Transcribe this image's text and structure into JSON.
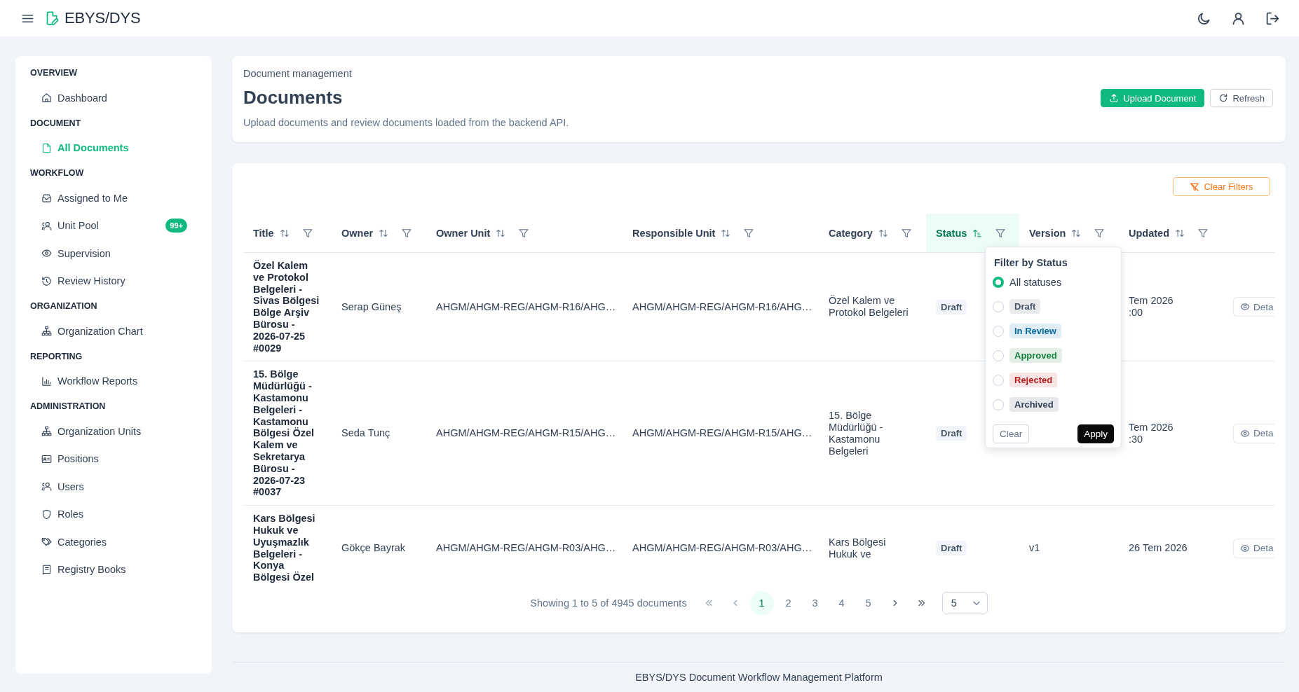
{
  "topbar": {
    "brand": "EBYS/DYS"
  },
  "sidebar": {
    "sections": [
      {
        "heading": "OVERVIEW",
        "items": [
          {
            "label": "Dashboard",
            "selected": false
          }
        ]
      },
      {
        "heading": "DOCUMENT",
        "items": [
          {
            "label": "All Documents",
            "selected": true
          }
        ]
      },
      {
        "heading": "WORKFLOW",
        "items": [
          {
            "label": "Assigned to Me",
            "selected": false
          },
          {
            "label": "Unit Pool",
            "selected": false,
            "badge": "99+"
          },
          {
            "label": "Supervision",
            "selected": false
          },
          {
            "label": "Review History",
            "selected": false
          }
        ]
      },
      {
        "heading": "ORGANIZATION",
        "items": [
          {
            "label": "Organization Chart",
            "selected": false
          }
        ]
      },
      {
        "heading": "REPORTING",
        "items": [
          {
            "label": "Workflow Reports",
            "selected": false
          }
        ]
      },
      {
        "heading": "ADMINISTRATION",
        "items": [
          {
            "label": "Organization Units",
            "selected": false
          },
          {
            "label": "Positions",
            "selected": false
          },
          {
            "label": "Users",
            "selected": false
          },
          {
            "label": "Roles",
            "selected": false
          },
          {
            "label": "Categories",
            "selected": false
          },
          {
            "label": "Registry Books",
            "selected": false
          }
        ]
      }
    ]
  },
  "page_header": {
    "breadcrumb": "Document management",
    "title": "Documents",
    "description": "Upload documents and review documents loaded from the backend API.",
    "buttons": [
      {
        "label": "Upload Document",
        "kind": "primary"
      },
      {
        "label": "Refresh",
        "kind": "secondary"
      }
    ]
  },
  "documents_table": {
    "clear_filters": "Clear Filters",
    "columns": [
      {
        "label": "Title",
        "sorted": false
      },
      {
        "label": "Owner",
        "sorted": false
      },
      {
        "label": "Owner Unit",
        "sorted": false
      },
      {
        "label": "Responsible Unit",
        "sorted": false
      },
      {
        "label": "Category",
        "sorted": false
      },
      {
        "label": "Status",
        "sorted": true
      },
      {
        "label": "Version",
        "sorted": false
      },
      {
        "label": "Updated",
        "sorted": false
      }
    ],
    "rows": [
      {
        "title": "Özel Kalem ve Protokol Belgeleri - Sivas Bölgesi Bölge Arşiv Bürosu - 2026-07-25 #0029",
        "owner": "Serap Güneş",
        "owner_unit": "AHGM/AHGM-REG/AHGM-R16/AHG…",
        "responsible_unit": "AHGM/AHGM-REG/AHGM-R16/AHG…",
        "category": "Özel Kalem ve Protokol Belgeleri",
        "status": "Draft",
        "updated": "Tem 2026\n:00",
        "action": "Deta"
      },
      {
        "title": "15. Bölge Müdürlüğü - Kastamonu Belgeleri - Kastamonu Bölgesi Özel Kalem ve Sekretarya Bürosu - 2026-07-23 #0037",
        "owner": "Seda Tunç",
        "owner_unit": "AHGM/AHGM-REG/AHGM-R15/AHG…",
        "responsible_unit": "AHGM/AHGM-REG/AHGM-R15/AHG…",
        "category": "15. Bölge Müdürlüğü - Kastamonu Belgeleri",
        "status": "Draft",
        "updated": "Tem 2026\n:30",
        "action": "Deta"
      },
      {
        "title": "Kars Bölgesi Hukuk ve Uyuşmazlık Belgeleri - Konya Bölgesi Özel",
        "owner": "Gökçe Bayrak",
        "owner_unit": "AHGM/AHGM-REG/AHGM-R03/AHG…",
        "responsible_unit": "AHGM/AHGM-REG/AHGM-R03/AHG…",
        "category": "Kars Bölgesi Hukuk ve",
        "status": "Draft",
        "version": "v1",
        "updated": "26 Tem 2026",
        "action": "Deta"
      }
    ],
    "status_filter": {
      "title": "Filter by Status",
      "options": [
        {
          "label": "All statuses",
          "kind": "plain",
          "selected": true
        },
        {
          "label": "Draft",
          "kind": "badge",
          "color": "#475569",
          "selected": false
        },
        {
          "label": "In Review",
          "kind": "badge",
          "color": "#0369a1",
          "selected": false
        },
        {
          "label": "Approved",
          "kind": "badge",
          "color": "#15803d",
          "selected": false
        },
        {
          "label": "Rejected",
          "kind": "badge",
          "color": "#b91c1c",
          "selected": false
        },
        {
          "label": "Archived",
          "kind": "badge",
          "color": "#334155",
          "selected": false
        }
      ],
      "clear": "Clear",
      "apply": "Apply"
    },
    "pagination": {
      "summary": "Showing 1 to 5 of 4945 documents",
      "nav_before": [
        {
          "kind": "first",
          "disabled": true
        },
        {
          "kind": "previous",
          "disabled": true
        }
      ],
      "pages": [
        {
          "label": "1",
          "selected": true
        },
        {
          "label": "2",
          "selected": false
        },
        {
          "label": "3",
          "selected": false
        },
        {
          "label": "4",
          "selected": false
        },
        {
          "label": "5",
          "selected": false
        }
      ],
      "nav_after": [
        {
          "kind": "next",
          "disabled": false
        },
        {
          "kind": "last",
          "disabled": false
        }
      ],
      "page_size": "5"
    }
  },
  "footer": "EBYS/DYS Document Workflow Management Platform"
}
